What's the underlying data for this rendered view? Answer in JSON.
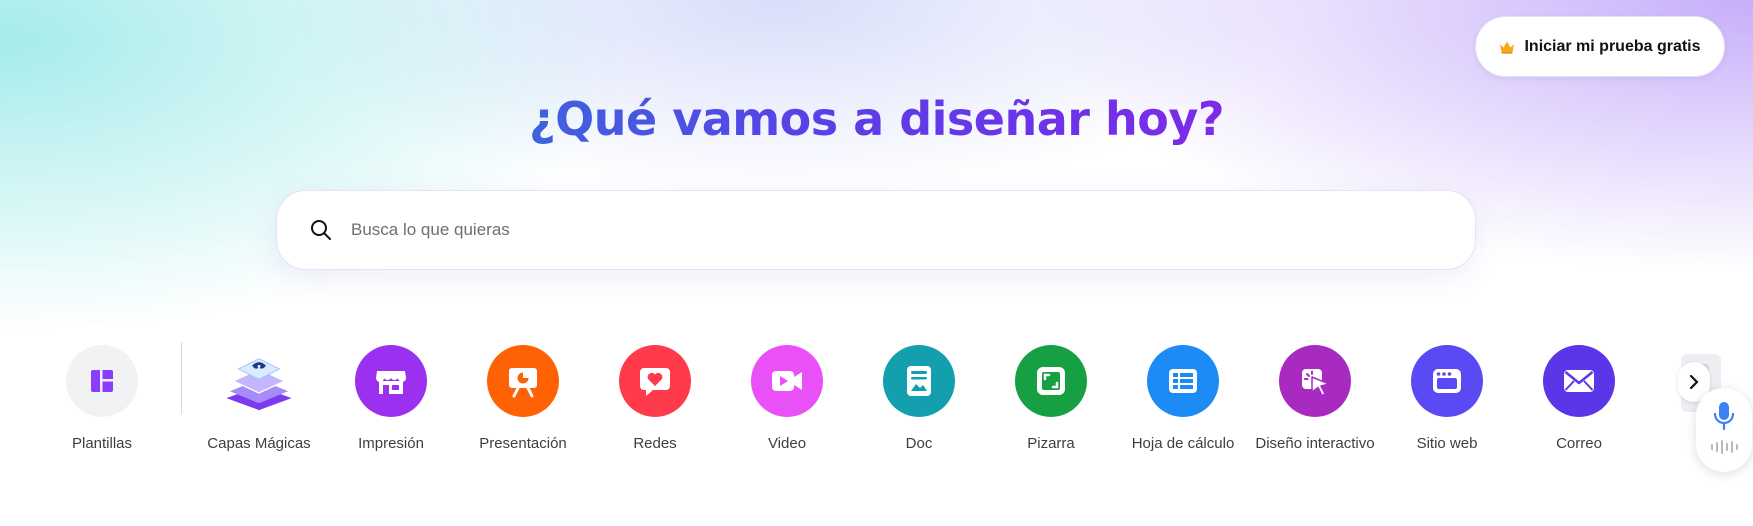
{
  "header": {
    "trial_button_label": "Iniciar mi prueba gratis",
    "trial_icon": "crown-icon",
    "crown_color": "#f6a91c"
  },
  "hero": {
    "title": "¿Qué vamos a diseñar hoy?"
  },
  "search": {
    "placeholder": "Busca lo que quieras",
    "value": "",
    "icon": "search-icon"
  },
  "categories": [
    {
      "label": "Plantillas",
      "icon": "layout-icon",
      "color": "#f1f2f4"
    },
    {
      "label": "Capas Mágicas",
      "icon": "magic-layers-icon",
      "color": "#8b5cf6"
    },
    {
      "label": "Impresión",
      "icon": "store-icon",
      "color": "#9b30f0"
    },
    {
      "label": "Presentación",
      "icon": "presentation-icon",
      "color": "#ff6105"
    },
    {
      "label": "Redes",
      "icon": "heart-chat-icon",
      "color": "#ff3b4b"
    },
    {
      "label": "Video",
      "icon": "video-camera-icon",
      "color": "#e950f7"
    },
    {
      "label": "Doc",
      "icon": "doc-icon",
      "color": "#139fae"
    },
    {
      "label": "Pizarra",
      "icon": "whiteboard-icon",
      "color": "#17a043"
    },
    {
      "label": "Hoja de cálculo",
      "icon": "spreadsheet-icon",
      "color": "#1d8bf5"
    },
    {
      "label": "Diseño interactivo",
      "icon": "cursor-click-icon",
      "color": "#a82ac1"
    },
    {
      "label": "Sitio web",
      "icon": "website-icon",
      "color": "#5a4af4"
    },
    {
      "label": "Correo",
      "icon": "mail-icon",
      "color": "#5b35e8"
    }
  ],
  "controls": {
    "next_icon": "chevron-right-icon",
    "mic_icon": "microphone-icon",
    "mic_color": "#3b82f6"
  }
}
